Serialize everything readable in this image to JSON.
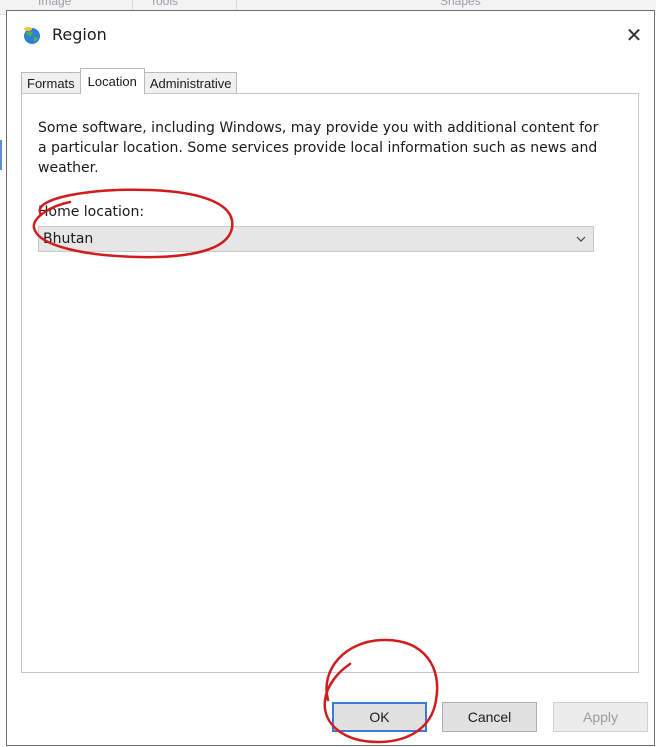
{
  "background_app": {
    "menu_items": [
      "Image",
      "Tools",
      "Shapes"
    ]
  },
  "dialog": {
    "title": "Region",
    "title_icon": "globe-icon",
    "close_glyph": "✕"
  },
  "tabs": [
    {
      "label": "Formats",
      "active": false
    },
    {
      "label": "Location",
      "active": true
    },
    {
      "label": "Administrative",
      "active": false
    }
  ],
  "location": {
    "description": "Some software, including Windows, may provide you with additional content for a particular location. Some services provide local information such as news and weather.",
    "home_location_label": "Home location:",
    "home_location_value": "Bhutan"
  },
  "buttons": {
    "ok": "OK",
    "cancel": "Cancel",
    "apply": "Apply",
    "apply_enabled": false
  },
  "annotations": {
    "color": "#d01c1c",
    "circled": [
      "home-location",
      "ok-button"
    ]
  }
}
